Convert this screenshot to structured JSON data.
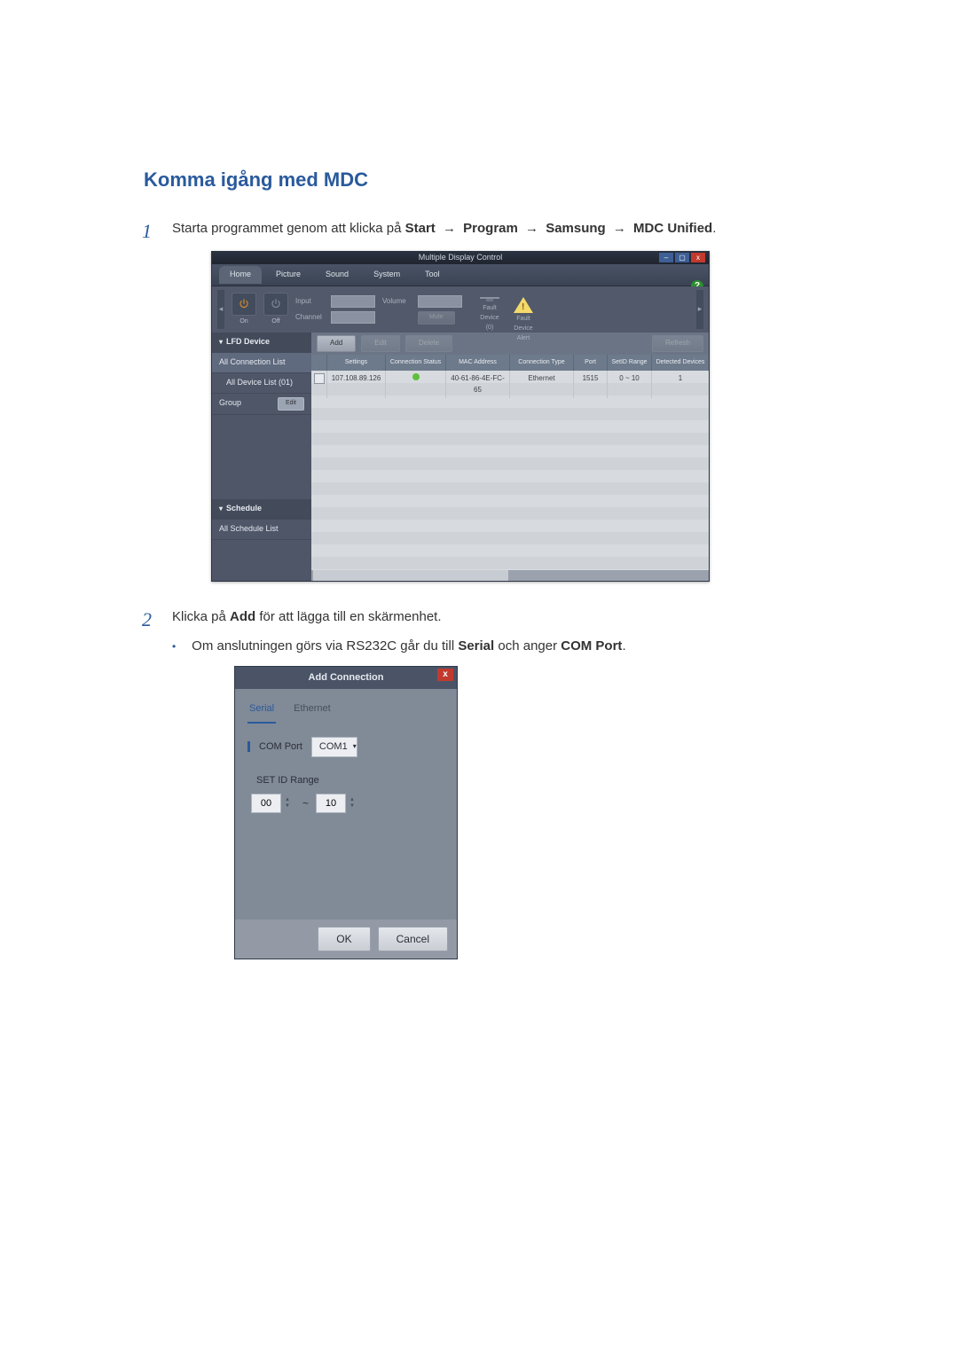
{
  "page": {
    "title": "Komma igång med MDC",
    "step1": {
      "num": "1",
      "prefix": "Starta programmet genom att klicka på ",
      "path": [
        "Start",
        "Program",
        "Samsung",
        "MDC Unified"
      ],
      "arrow": "→",
      "suffix": "."
    },
    "step2": {
      "num": "2",
      "text_pre": "Klicka på ",
      "text_bold": "Add",
      "text_post": " för att lägga till en skärmenhet.",
      "sub_pre": "Om anslutningen görs via RS232C går du till ",
      "sub_b1": "Serial",
      "sub_mid": " och anger ",
      "sub_b2": "COM Port",
      "sub_post": "."
    }
  },
  "mdc": {
    "window_title": "Multiple Display Control",
    "help_glyph": "?",
    "menus": [
      "Home",
      "Picture",
      "Sound",
      "System",
      "Tool"
    ],
    "active_menu_index": 0,
    "toolbar": {
      "on_label": "On",
      "off_label": "Off",
      "input_label": "Input",
      "channel_label": "Channel",
      "volume_label": "Volume",
      "mute_btn": "Mute",
      "fault_device": "Fault Device (0)",
      "fault_alert": "Fault Device Alert"
    },
    "side": {
      "lfd_header": "LFD Device",
      "all_conn": "All Connection List",
      "all_device": "All Device List (01)",
      "group": "Group",
      "edit": "Edit",
      "schedule_header": "Schedule",
      "all_schedule": "All Schedule List"
    },
    "actions": {
      "add": "Add",
      "edit": "Edit",
      "delete": "Delete",
      "refresh": "Refresh"
    },
    "grid": {
      "headers": [
        "",
        "Settings",
        "Connection Status",
        "MAC Address",
        "Connection Type",
        "Port",
        "SetID Range",
        "Detected Devices"
      ],
      "row": {
        "settings": "107.108.89.126",
        "status_dot": "online",
        "mac": "40-61-86-4E-FC-65",
        "ctype": "Ethernet",
        "port": "1515",
        "range": "0 ~ 10",
        "detected": "1"
      }
    }
  },
  "dialog": {
    "title": "Add Connection",
    "tabs": {
      "serial": "Serial",
      "ethernet": "Ethernet"
    },
    "com_label": "COM Port",
    "com_value": "COM1",
    "setid_label": "SET ID Range",
    "range_from": "00",
    "range_to": "10",
    "tilde": "~",
    "ok": "OK",
    "cancel": "Cancel"
  }
}
